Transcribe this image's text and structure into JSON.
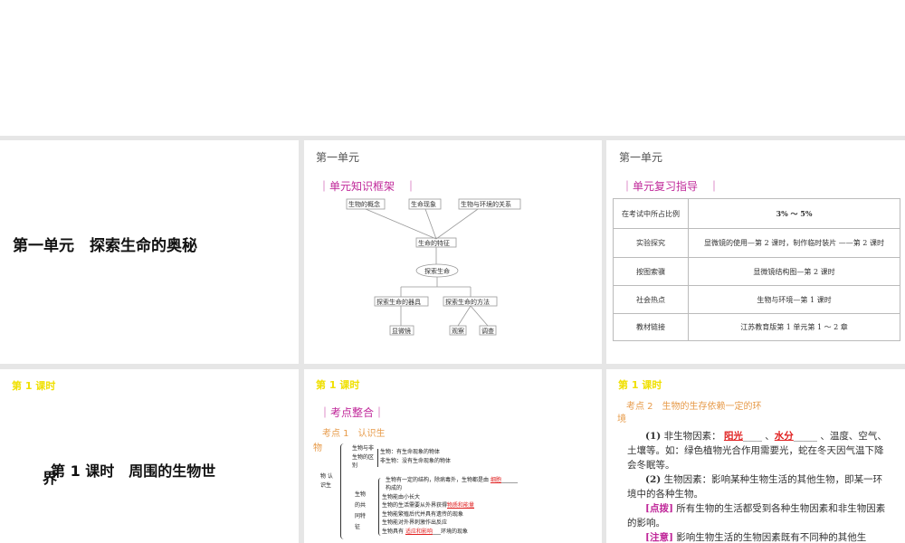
{
  "slides": [
    {
      "title": "第一单元　探索生命的奥秘"
    },
    {
      "unit": "第一单元",
      "section": "｜单元知识框架　｜",
      "nodes": {
        "concept": "生物的概念",
        "phenomena": "生命现象",
        "relation": "生物与环境的关系",
        "features": "生命的特征",
        "center": "探索生命",
        "tools": "探索生命的器具",
        "methods": "探索生命的方法",
        "microscope": "显微镜",
        "observe": "观察",
        "survey": "调查"
      }
    },
    {
      "unit": "第一单元",
      "section": "｜单元复习指导　｜",
      "rows": [
        [
          "在考试中所占比例",
          "3% ～ 5%"
        ],
        [
          "实验探究",
          "显微镜的使用—第 2 课时，制作临时装片 ——第 2 课时"
        ],
        [
          "按图索骥",
          "显微镜结构图—第 2 课时"
        ],
        [
          "社会热点",
          "生物与环境—第 1 课时"
        ],
        [
          "教材链接",
          "江苏教育版第 1 单元第 1 ～ 2 章"
        ]
      ]
    },
    {
      "lesson": "第 1 课时",
      "title": "第 1 课时　周围的生物世",
      "title_wrap": "界"
    },
    {
      "lesson": "第 1 课时",
      "section": "｜考点整合｜",
      "point": "考点 1　认识生",
      "point_wrap": "物",
      "root": "物 认识生",
      "g1": "生物与非生物的区别",
      "g1_items": [
        "生物：有生命现象的物体",
        "非生物：没有生命现象的物体"
      ],
      "g2": "生物的共同特征",
      "g2_items": {
        "a1": "生物有一定的结构，除病毒外，生物都是由",
        "a_blank": "细胞",
        "a2": "构成的",
        "b": "生物能由小长大",
        "c1": "生物的生活需要从外界获得",
        "c_blank": "物质和能量",
        "d": "生物能繁殖后代并具有遗传的现象",
        "e": "生物能对外界刺激作出反应",
        "f1": "生物具有",
        "f_blank": "适应和影响",
        "f2": "环境的现象"
      }
    },
    {
      "lesson": "第 1 课时",
      "point": "考点 2　生物的生存依赖一定的环",
      "point_wrap": "境",
      "p1_num": "(1)",
      "p1a": " 非生物因素：",
      "b1": "阳光",
      "sep": " 、",
      "b2": "水分",
      "p1b": " 、温度、空气、土壤等。如：绿色植物光合作用需要光，蛇在冬天因气温下降会冬眠等。",
      "p2_num": "(2)",
      "p2": " 生物因素：影响某种生物生活的其他生物，即某一环境中的各种生物。",
      "tip_label": "[点拨]",
      "tip": " 所有生物的生活都受到各种生物因素和非生物因素的影响。",
      "note_label": "[注意]",
      "note": " 影响生物生活的生物因素既有不同种的其他生"
    }
  ]
}
